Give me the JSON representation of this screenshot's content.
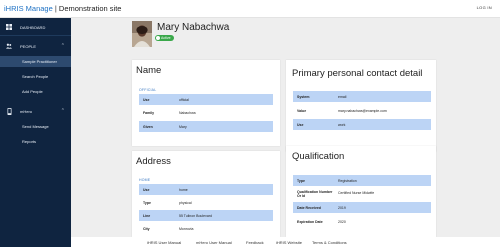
{
  "header": {
    "brand": "iHRIS Manage",
    "separator": "|",
    "site": "Demonstration site",
    "login": "LOG IN"
  },
  "sidebar": {
    "dashboard": "DASHBOARD",
    "people": "PEOPLE",
    "people_children": [
      "Sample Practitioner",
      "Search People",
      "Add People"
    ],
    "mhero": "mHero",
    "mhero_children": [
      "Send Message",
      "Reports"
    ]
  },
  "profile": {
    "name": "Mary Nabachwa",
    "status": "Active"
  },
  "name_card": {
    "title": "Name",
    "section": "OFFICIAL",
    "rows": [
      {
        "key": "Use",
        "value": "official"
      },
      {
        "key": "Family",
        "value": "Nabachwa"
      },
      {
        "key": "Given",
        "value": "Mary"
      }
    ]
  },
  "contact_card": {
    "title": "Primary personal contact detail",
    "rows": [
      {
        "key": "System",
        "value": "email"
      },
      {
        "key": "Value",
        "value": "mary.nabachwa@example.com"
      },
      {
        "key": "Use",
        "value": "work"
      }
    ]
  },
  "address_card": {
    "title": "Address",
    "section": "HOME",
    "rows": [
      {
        "key": "Use",
        "value": "home"
      },
      {
        "key": "Type",
        "value": "physical"
      },
      {
        "key": "Line",
        "value": "55 Tulinon Boulevard"
      },
      {
        "key": "City",
        "value": "Monrovia"
      }
    ]
  },
  "qualification_card": {
    "title": "Qualification",
    "rows": [
      {
        "key": "Type",
        "value": "Registration"
      },
      {
        "key": "Qualification Number Or Id",
        "value": "Certified Nurse Midwife"
      },
      {
        "key": "Date Received",
        "value": "2019"
      },
      {
        "key": "Expiration Date",
        "value": "2020"
      }
    ]
  },
  "footer": [
    "iHRIS User Manual",
    "mHero User Manual",
    "Feedback",
    "iHRIS Website",
    "Terms & Conditions"
  ],
  "colors": {
    "sidebar_bg": "#0f2440",
    "accent": "#1f72c4",
    "row_shade": "#bcd4f5",
    "active_badge": "#3aa84a"
  }
}
